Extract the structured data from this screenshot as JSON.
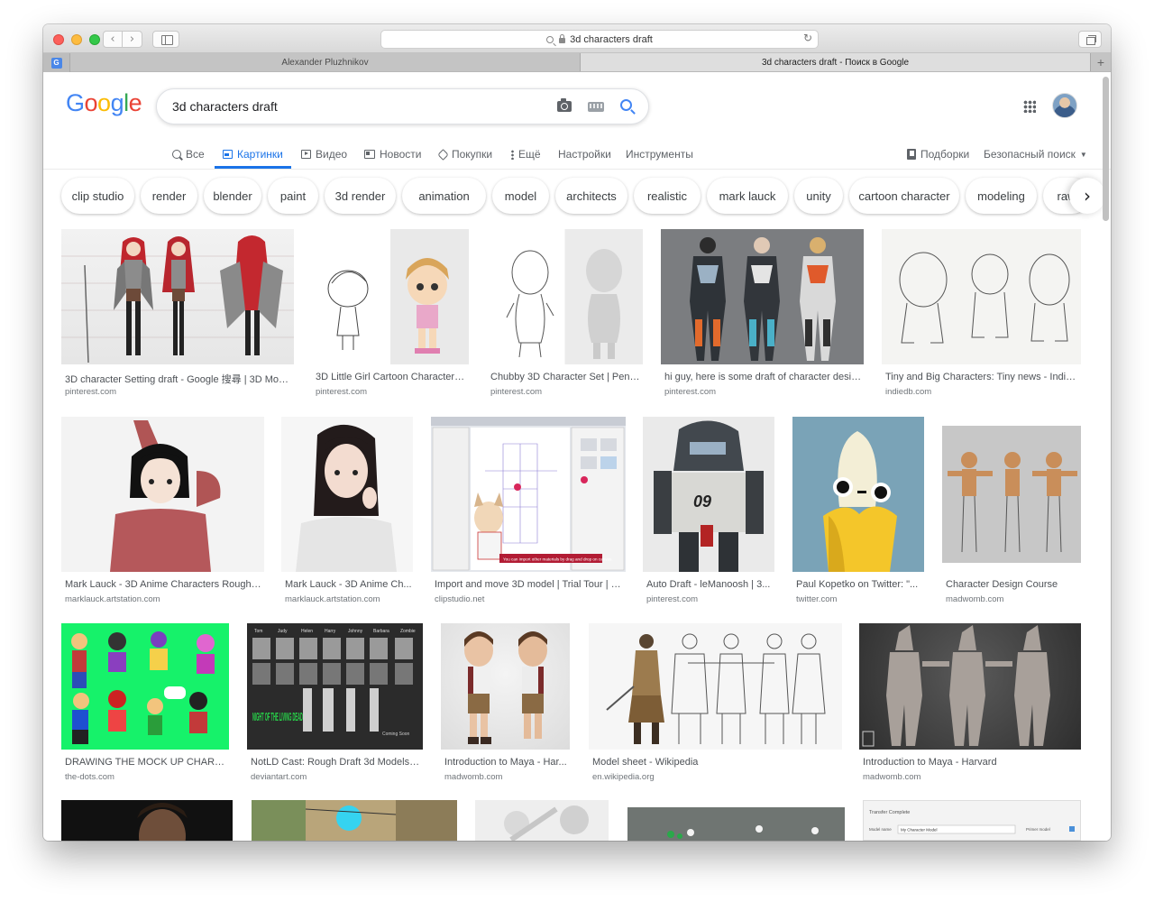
{
  "browser": {
    "address": "3d characters draft",
    "tabs": [
      {
        "label": "Alexander Pluzhnikov",
        "active": false
      },
      {
        "label": "3d characters draft - Поиск в Google",
        "active": true
      }
    ]
  },
  "google": {
    "logo": "Google",
    "query": "3d characters draft",
    "nav": {
      "all": "Все",
      "images": "Картинки",
      "video": "Видео",
      "news": "Новости",
      "shopping": "Покупки",
      "more": "Ещё",
      "settings": "Настройки",
      "tools": "Инструменты",
      "collections": "Подборки",
      "safesearch": "Безопасный поиск"
    },
    "chips": [
      "clip studio",
      "render",
      "blender",
      "paint",
      "3d render",
      "animation",
      "model",
      "architects",
      "realistic",
      "mark lauck",
      "unity",
      "cartoon character",
      "modeling",
      "raw"
    ]
  },
  "results": [
    {
      "title": "3D character Setting draft - Google 搜尋 | 3D Mod...",
      "source": "pinterest.com"
    },
    {
      "title": "3D Little Girl Cartoon Character | ...",
      "source": "pinterest.com"
    },
    {
      "title": "Chubby 3D Character Set | Penc...",
      "source": "pinterest.com"
    },
    {
      "title": "hi guy, here is some draft of character desig...",
      "source": "pinterest.com"
    },
    {
      "title": "Tiny and Big Characters: Tiny news - Indie ...",
      "source": "indiedb.com"
    },
    {
      "title": "Mark Lauck - 3D Anime Characters Rough ...",
      "source": "marklauck.artstation.com"
    },
    {
      "title": "Mark Lauck - 3D Anime Ch...",
      "source": "marklauck.artstation.com"
    },
    {
      "title": "Import and move 3D model | Trial Tour | C...",
      "source": "clipstudio.net"
    },
    {
      "title": "Auto Draft - leManoosh | 3...",
      "source": "pinterest.com"
    },
    {
      "title": "Paul Kopetko on Twitter: \"...",
      "source": "twitter.com"
    },
    {
      "title": "Character Design Course",
      "source": "madwomb.com"
    },
    {
      "title": "DRAWING THE MOCK UP CHARA...",
      "source": "the-dots.com"
    },
    {
      "title": "NotLD Cast: Rough Draft 3d Models ...",
      "source": "deviantart.com"
    },
    {
      "title": "Introduction to Maya - Har...",
      "source": "madwomb.com"
    },
    {
      "title": "Model sheet - Wikipedia",
      "source": "en.wikipedia.org"
    },
    {
      "title": "Introduction to Maya - Harvard",
      "source": "madwomb.com"
    }
  ],
  "thumb_texts": {
    "clipstudio_caption": "You can import other materials by drag and drop on canvas.",
    "robot_number": "09",
    "notld_text": "NIGHT OF THE LIVING DEAD",
    "notld_soon": "Coming Soon",
    "notld_cast": [
      "Tom",
      "Judy",
      "Helen",
      "Harry",
      "Johnny",
      "Barbara",
      "Zombie"
    ],
    "transfer_title": "Transfer Complete",
    "model_name_label": "Model name",
    "model_name_value": "My Character Model",
    "primer_label": "Primer model"
  },
  "colors": {
    "google_blue": "#4285f4",
    "google_red": "#ea4335",
    "google_yellow": "#fbbc05",
    "google_green": "#34a853",
    "active_tab": "#1a73e8"
  }
}
